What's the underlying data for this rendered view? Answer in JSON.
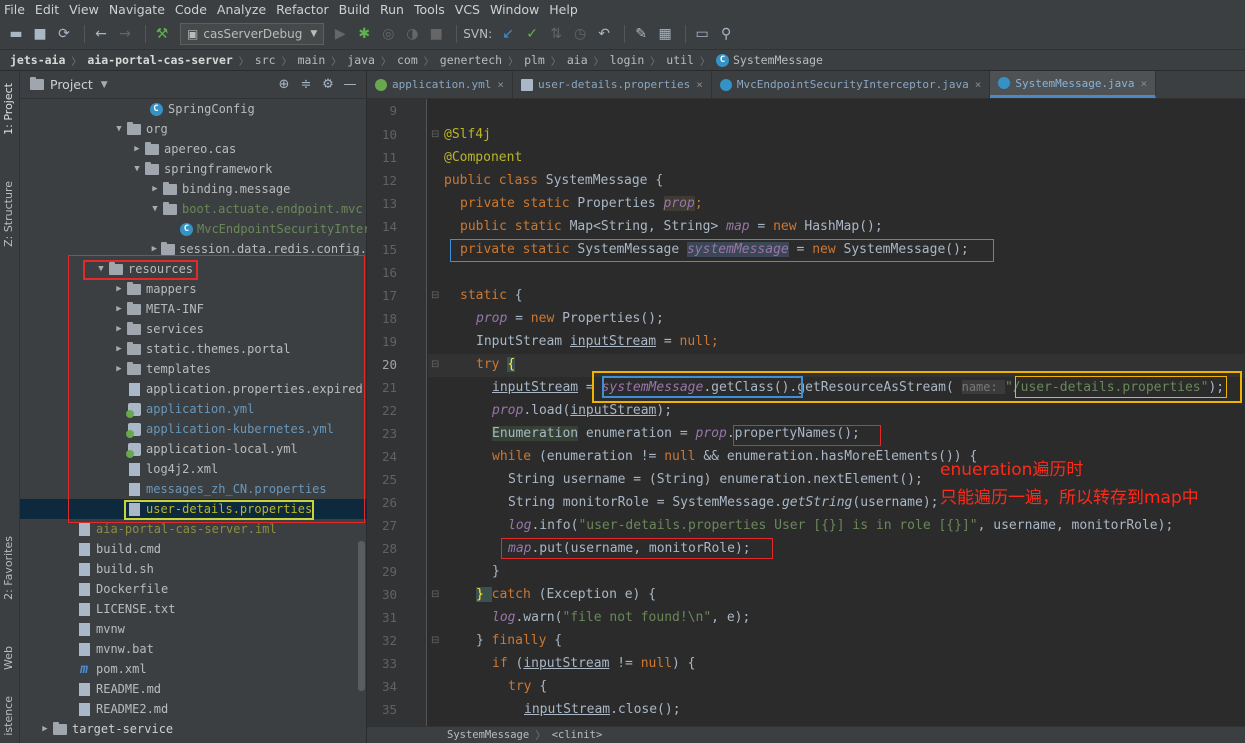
{
  "menu": [
    "File",
    "Edit",
    "View",
    "Navigate",
    "Code",
    "Analyze",
    "Refactor",
    "Build",
    "Run",
    "Tools",
    "VCS",
    "Window",
    "Help"
  ],
  "toolbar": {
    "run_config": "casServerDebug",
    "svn_label": "SVN:"
  },
  "breadcrumbs": [
    "jets-aia",
    "aia-portal-cas-server",
    "src",
    "main",
    "java",
    "com",
    "genertech",
    "plm",
    "aia",
    "login",
    "util",
    "SystemMessage"
  ],
  "left_strip": {
    "project": "1: Project",
    "structure": "Z: Structure",
    "favorites": "2: Favorites",
    "web": "Web",
    "persistence": "istence"
  },
  "project_panel": {
    "title": "Project",
    "tree": [
      {
        "label": "SpringConfig"
      },
      {
        "label": "org"
      },
      {
        "label": "apereo.cas"
      },
      {
        "label": "springframework"
      },
      {
        "label": "binding.message"
      },
      {
        "label": "boot.actuate.endpoint.mvc"
      },
      {
        "label": "MvcEndpointSecurityInter"
      },
      {
        "label": "session.data.redis.config."
      },
      {
        "label": "resources"
      },
      {
        "label": "mappers"
      },
      {
        "label": "META-INF"
      },
      {
        "label": "services"
      },
      {
        "label": "static.themes.portal"
      },
      {
        "label": "templates"
      },
      {
        "label": "application.properties.expired"
      },
      {
        "label": "application.yml"
      },
      {
        "label": "application-kubernetes.yml"
      },
      {
        "label": "application-local.yml"
      },
      {
        "label": "log4j2.xml"
      },
      {
        "label": "messages_zh_CN.properties"
      },
      {
        "label": "user-details.properties"
      },
      {
        "label": "aia-portal-cas-server.iml"
      },
      {
        "label": "build.cmd"
      },
      {
        "label": "build.sh"
      },
      {
        "label": "Dockerfile"
      },
      {
        "label": "LICENSE.txt"
      },
      {
        "label": "mvnw"
      },
      {
        "label": "mvnw.bat"
      },
      {
        "label": "pom.xml"
      },
      {
        "label": "README.md"
      },
      {
        "label": "README2.md"
      },
      {
        "label": "target-service"
      }
    ]
  },
  "tabs": [
    {
      "label": "application.yml"
    },
    {
      "label": "user-details.properties"
    },
    {
      "label": "MvcEndpointSecurityInterceptor.java"
    },
    {
      "label": "SystemMessage.java"
    }
  ],
  "gutter": [
    "9",
    "10",
    "11",
    "12",
    "13",
    "14",
    "15",
    "16",
    "17",
    "18",
    "19",
    "20",
    "21",
    "22",
    "23",
    "24",
    "25",
    "26",
    "27",
    "28",
    "29",
    "30",
    "31",
    "32",
    "33",
    "34",
    "35"
  ],
  "code": {
    "l10": "@Slf4j",
    "l11": "@Component",
    "l12a": "public class ",
    "l12b": "SystemMessage {",
    "l13a": "private static ",
    "l13b": "Properties ",
    "l13c": "prop",
    "l13d": ";",
    "l14a": "public static ",
    "l14b": "Map<String, String> ",
    "l14c": "map",
    "l14d": " = ",
    "l14e": "new ",
    "l14f": "HashMap();",
    "l15a": "private static ",
    "l15b": "SystemMessage ",
    "l15c": "systemMessage",
    "l15d": " = ",
    "l15e": "new ",
    "l15f": "SystemMessage();",
    "l17a": "static ",
    "l17b": "{",
    "l18a": "prop",
    "l18b": " = ",
    "l18c": "new ",
    "l18d": "Properties();",
    "l19a": "InputStream ",
    "l19b": "inputStream",
    "l19c": " = ",
    "l19d": "null",
    "l19e": ";",
    "l20a": "try ",
    "l20b": "{",
    "l21a": "inputStream",
    "l21b": " = ",
    "l21c": "systemMessage",
    "l21d": ".getClass()",
    "l21e": ".getResourceAsStream( ",
    "l21f": "name: ",
    "l21g": "\"/user-details.properties\"",
    "l21h": ");",
    "l22a": "prop",
    "l22b": ".load(",
    "l22c": "inputStream",
    "l22d": ");",
    "l23a": "Enumeration",
    "l23b": " enumeration = ",
    "l23c": "prop",
    "l23d": ".propertyNames();",
    "l24a": "while ",
    "l24b": "(enumeration != ",
    "l24c": "null ",
    "l24d": "&& enumeration.hasMoreElements()) {",
    "l25": "String username = (String) enumeration.nextElement();",
    "l26a": "String monitorRole = SystemMessage.",
    "l26b": "getString",
    "l26c": "(username);",
    "l27a": "log",
    "l27b": ".info(",
    "l27c": "\"user-details.properties User [{}] is in role [{}]\"",
    "l27d": ", username, monitorRole);",
    "l28a": "map",
    "l28b": ".put(username, monitorRole);",
    "l29": "}",
    "l30a": "} ",
    "l30b": "catch ",
    "l30c": "(Exception e) {",
    "l31a": "log",
    "l31b": ".warn(",
    "l31c": "\"file not found!\\n\"",
    "l31d": ", e);",
    "l32a": "} ",
    "l32b": "finally ",
    "l32c": "{",
    "l33a": "if ",
    "l33b": "(",
    "l33c": "inputStream",
    "l33d": " != ",
    "l33e": "null",
    "l33f": ") {",
    "l34a": "try ",
    "l34b": "{",
    "l35a": "inputStream",
    "l35b": ".close();"
  },
  "annotation": {
    "line1": "enueration遍历时",
    "line2": "只能遍历一遍，所以转存到map中"
  },
  "status": {
    "class": "SystemMessage",
    "method": "<clinit>"
  },
  "colors": {
    "accent": "#4a88c7",
    "annotation_red": "#ff2a1a",
    "highlight_yellow": "#f0b400",
    "highlight_blue": "#3d8fd6"
  }
}
